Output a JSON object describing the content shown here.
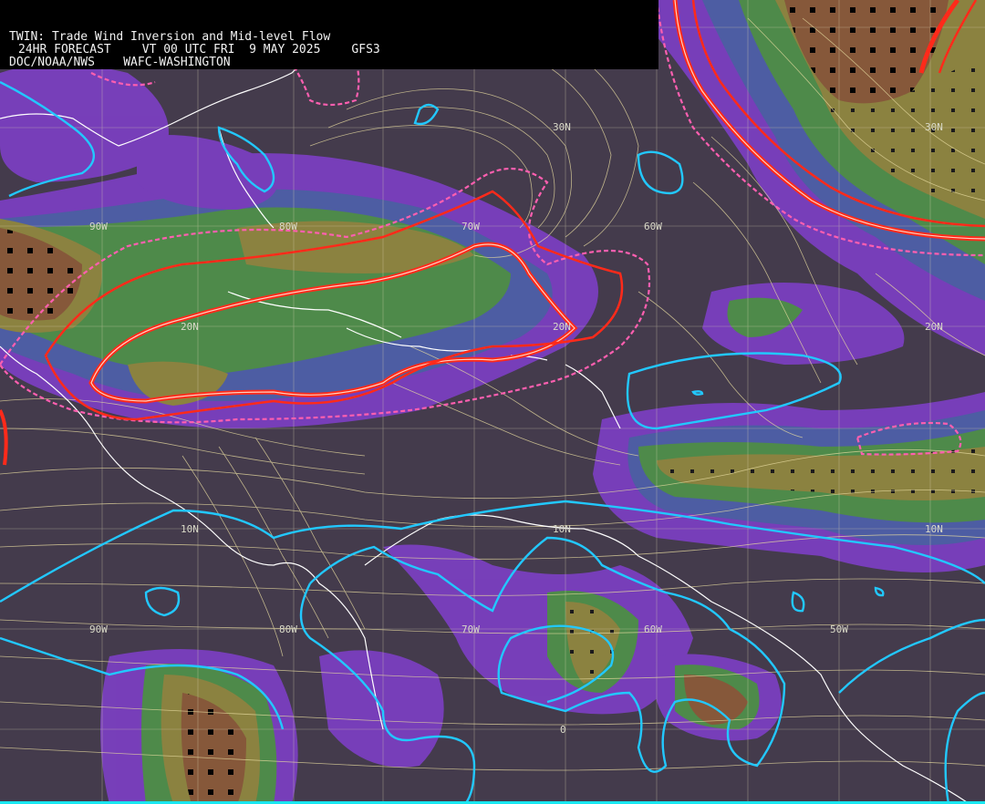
{
  "header": {
    "line1": "TWIN: Trade Wind Inversion and Mid-level Flow",
    "forecast": "24HR FORECAST",
    "valid_time": "VT 00 UTC FRI  9 MAY 2025",
    "model": "GFS3",
    "agency": "DOC/NOAA/NWS",
    "center": "WAFC-WASHINGTON"
  },
  "grid_labels": {
    "lat_30n_a": "30N",
    "lat_30n_b": "30N",
    "lat_20n_a": "20N",
    "lat_20n_b": "20N",
    "lat_20n_c": "20N",
    "lat_10n_a": "10N",
    "lat_10n_b": "10N",
    "lat_10n_c": "10N",
    "lat_0": "0",
    "lon_90w_a": "90W",
    "lon_80w_a": "80W",
    "lon_70w_a": "70W",
    "lon_60w_a": "60W",
    "lon_90w_b": "90W",
    "lon_80w_b": "80W",
    "lon_70w_b": "70W",
    "lon_60w_b": "60W",
    "lon_50w": "50W"
  },
  "colors": {
    "background": "#443b4c",
    "purple": "#7a3fbf",
    "blue_band": "#4e5fa8",
    "green": "#4f8f4a",
    "olive": "#8f8640",
    "brown": "#8a5a3a",
    "inversion_red": "#ff2a1a",
    "dashed_pink": "#ff5fb0",
    "cyan": "#22c8ff",
    "streamline": "#e8dca0",
    "coastline": "#ffffff"
  }
}
